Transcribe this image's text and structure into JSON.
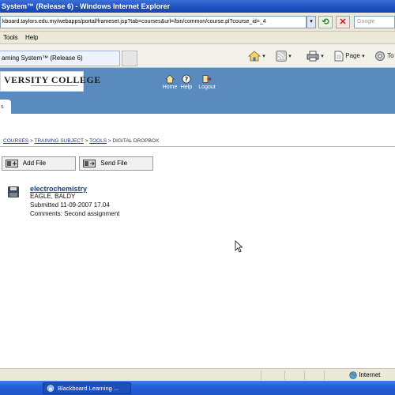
{
  "window": {
    "title": "System™ (Release 6) - Windows Internet Explorer"
  },
  "address_bar": {
    "url": "kboard.taylors.edu.my/webapps/portal/frameset.jsp?tab=courses&url=/bin/common/course.pl?course_id=_4",
    "search_placeholder": "Google"
  },
  "menu": {
    "items": [
      "Tools",
      "Help"
    ]
  },
  "tab": {
    "label": "arning System™ (Release 6)"
  },
  "command_bar": {
    "page_label": "Page",
    "tools_label": "To"
  },
  "header": {
    "logo_text": "VERSITY COLLEGE",
    "nav": [
      {
        "label": "Home",
        "icon": "home-icon"
      },
      {
        "label": "Help",
        "icon": "help-icon"
      },
      {
        "label": "Logout",
        "icon": "logout-icon"
      }
    ],
    "tab_nub": "s",
    "brand_color": "#5a8bbf"
  },
  "breadcrumb": {
    "items": [
      "COURSES",
      "TRAINING SUBJECT",
      "TOOLS"
    ],
    "current": "DIGITAL DROPBOX",
    "separator": ">"
  },
  "actions": {
    "add_file": "Add File",
    "send_file": "Send File"
  },
  "dropbox_item": {
    "title": "electrochemistry",
    "author": "EAGLE, BALDY",
    "submitted": "Submitted 11-09-2007 17.04",
    "comments": "Comments: Second assignment"
  },
  "status_bar": {
    "zone": "Internet"
  },
  "taskbar": {
    "window_label": "Blackboard Learning ..."
  }
}
